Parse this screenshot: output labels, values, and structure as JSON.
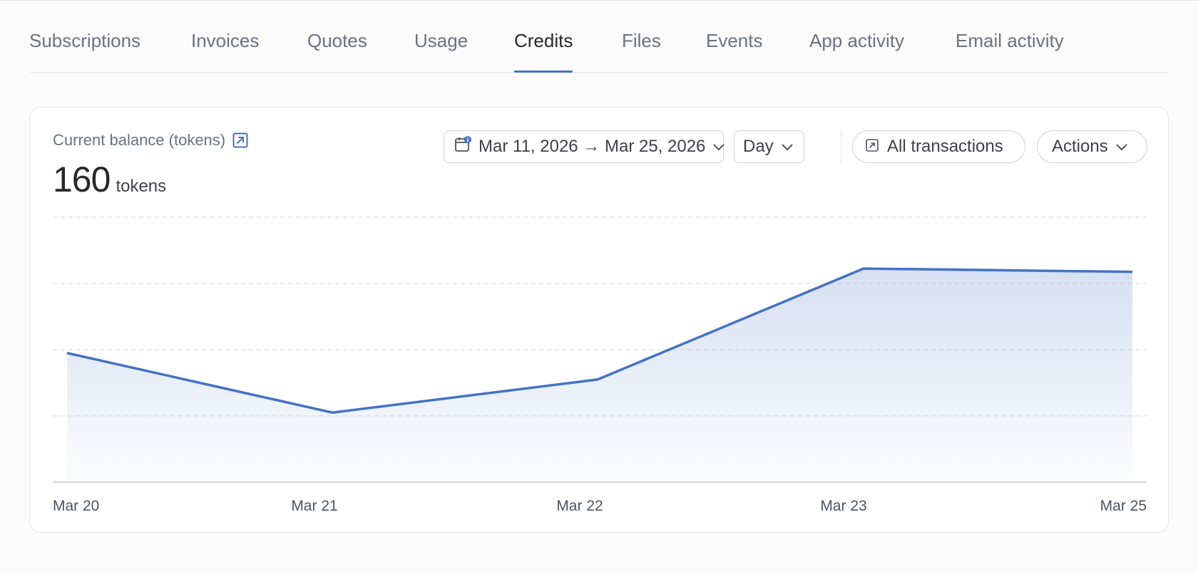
{
  "tabs": [
    {
      "label": "Subscriptions",
      "active": false
    },
    {
      "label": "Invoices",
      "active": false
    },
    {
      "label": "Quotes",
      "active": false
    },
    {
      "label": "Usage",
      "active": false
    },
    {
      "label": "Credits",
      "active": true
    },
    {
      "label": "Files",
      "active": false
    },
    {
      "label": "Events",
      "active": false
    },
    {
      "label": "App activity",
      "active": false
    },
    {
      "label": "Email activity",
      "active": false
    }
  ],
  "balance": {
    "label": "Current balance (tokens)",
    "value": "160",
    "unit": "tokens"
  },
  "controls": {
    "date_range": "Mar 11, 2026 → Mar 25, 2026",
    "granularity": "Day",
    "all_transactions": "All transactions",
    "actions": "Actions"
  },
  "colors": {
    "accent": "#4472c4",
    "line": "#4472c4"
  },
  "icons": {
    "date": "calendar-icon",
    "external": "external-link-icon",
    "dropdown": "chevron-down-icon"
  },
  "chart_data": {
    "type": "area",
    "x": [
      "Mar 20",
      "Mar 21",
      "Mar 22",
      "Mar 23",
      "Mar 25"
    ],
    "values": [
      78,
      42,
      62,
      129,
      127
    ],
    "ylim": [
      0,
      160
    ],
    "grid": true,
    "title": "",
    "xlabel": "",
    "ylabel": ""
  }
}
